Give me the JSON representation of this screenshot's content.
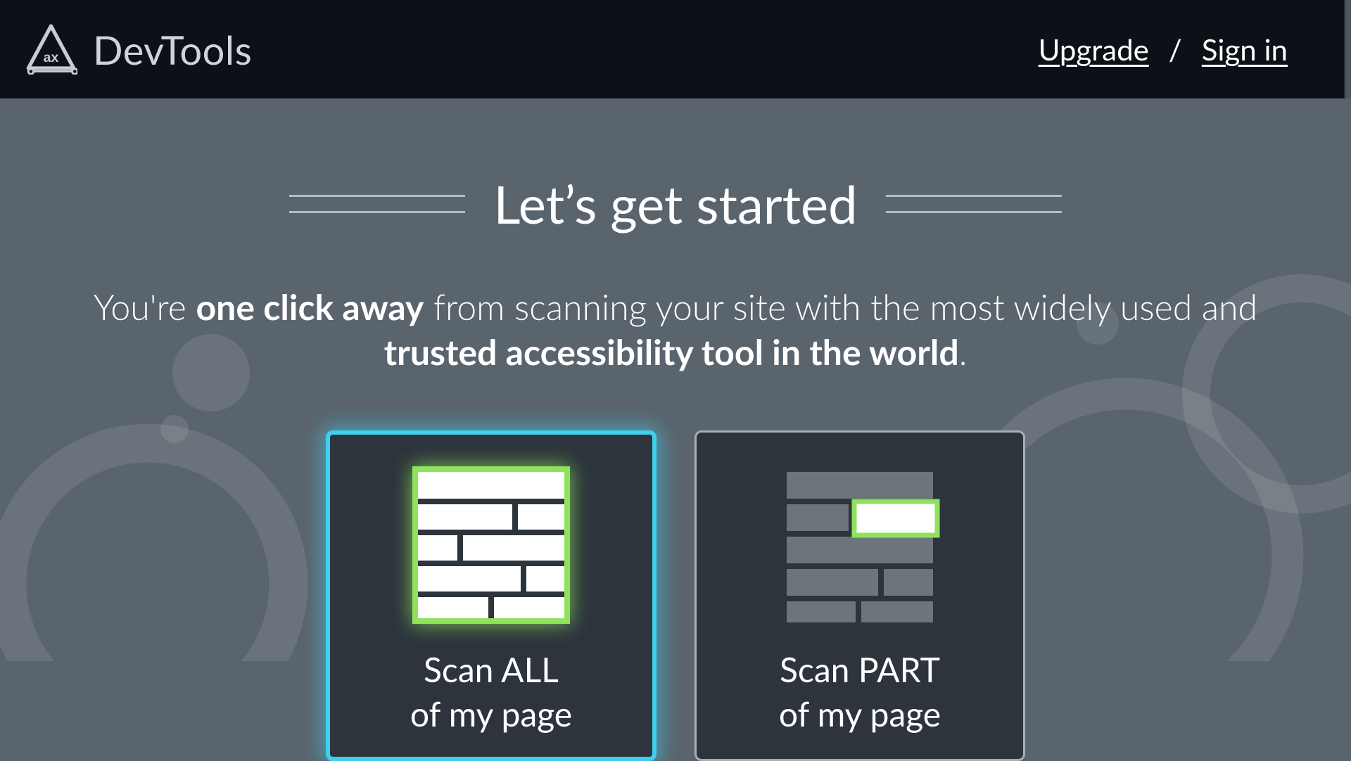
{
  "header": {
    "brand": "DevTools",
    "upgrade": "Upgrade",
    "separator": "/",
    "signin": "Sign in"
  },
  "main": {
    "title": "Let’s get started",
    "subtitle_pre": "You're ",
    "subtitle_bold1": "one click away",
    "subtitle_mid": " from scanning your site with the most widely used and ",
    "subtitle_bold2": "trusted accessibility tool in the world",
    "subtitle_post": "."
  },
  "cards": {
    "scan_all_line1": "Scan ALL",
    "scan_all_line2": "of my page",
    "scan_part_line1": "Scan PART",
    "scan_part_line2": "of my page"
  },
  "colors": {
    "accent_cyan": "#3fd0ef",
    "accent_green": "#8fe35c",
    "bg_dark": "#0c1017",
    "bg_main": "#5a646d",
    "card_bg": "#2d343c"
  },
  "icons": {
    "logo": "axe-triangle-icon",
    "scan_all": "page-grid-full-icon",
    "scan_part": "page-grid-partial-icon"
  }
}
